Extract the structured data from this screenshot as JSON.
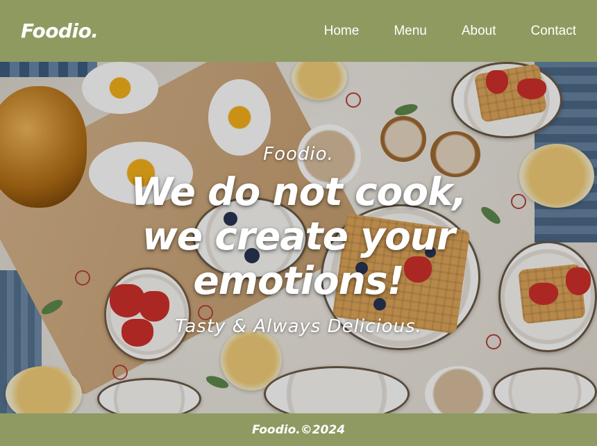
{
  "header": {
    "logo": "Foodio.",
    "nav": [
      {
        "label": "Home"
      },
      {
        "label": "Menu"
      },
      {
        "label": "About"
      },
      {
        "label": "Contact"
      }
    ]
  },
  "hero": {
    "brand": "Foodio.",
    "title_lines": [
      "We do not cook,",
      "we create your",
      "emotions!"
    ],
    "tagline": "Tasty & Always Delicious."
  },
  "footer": {
    "text": "Foodio.©2024"
  },
  "colors": {
    "header_bg": "#8f9a61",
    "footer_bg": "#8e9a62",
    "text": "#ffffff"
  }
}
